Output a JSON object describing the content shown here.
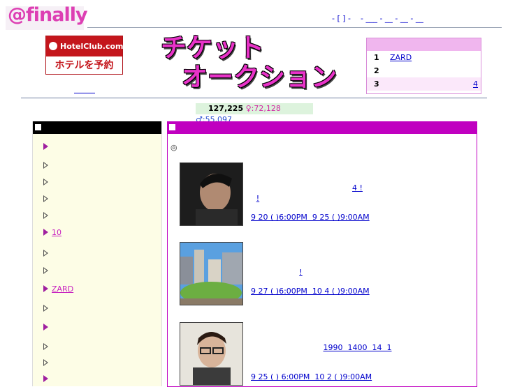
{
  "header": {
    "logo_text": "@finally",
    "top_links": "- [ ] -    - ___ - __ - __ - __",
    "hotel_ad_top": "HotelClub.com",
    "hotel_ad_bottom": "ホテルを予約",
    "title_line1": "チケット",
    "title_line2": "オークション"
  },
  "ranking": {
    "rows": [
      {
        "rank": "1",
        "label": "ZARD"
      },
      {
        "rank": "2",
        "label": ""
      },
      {
        "rank": "3",
        "label": "",
        "more": "4"
      }
    ]
  },
  "stats": {
    "total": "127,225",
    "female": "♀:72,128",
    "male": "♂:55,097"
  },
  "nav": {
    "items": [
      {
        "label": "",
        "active": true
      },
      {
        "label": "",
        "active": false
      },
      {
        "label": "",
        "active": false
      },
      {
        "label": "",
        "active": false
      },
      {
        "label": "",
        "active": false
      },
      {
        "label": "10",
        "active": true
      },
      {
        "label": "",
        "active": false
      },
      {
        "label": "",
        "active": false
      },
      {
        "label": "ZARD",
        "active": true
      },
      {
        "label": "",
        "active": false
      },
      {
        "label": "",
        "active": true
      },
      {
        "label": "",
        "active": false
      },
      {
        "label": "",
        "active": false
      },
      {
        "label": "",
        "active": true
      }
    ]
  },
  "main": {
    "bullet": "◎",
    "events": [
      {
        "title": "",
        "desc1": "4 !",
        "desc2": "!",
        "date": "9 20 ( )6:00PM  9 25 ( )9:00AM"
      },
      {
        "title": "",
        "desc1": "!",
        "desc2": "",
        "date": "9 27 ( )6:00PM  10 4 ( )9:00AM"
      },
      {
        "title": "",
        "desc1": "1990  1400  14  1",
        "desc2": "",
        "date": "9 25 ( ) 6:00PM  10 2 ( )9:00AM"
      }
    ]
  },
  "colors": {
    "accent_pink": "#c000c0",
    "logo_pink": "#dd3fb3",
    "link": "#0000cc",
    "nav_bg": "#fdfde6"
  }
}
